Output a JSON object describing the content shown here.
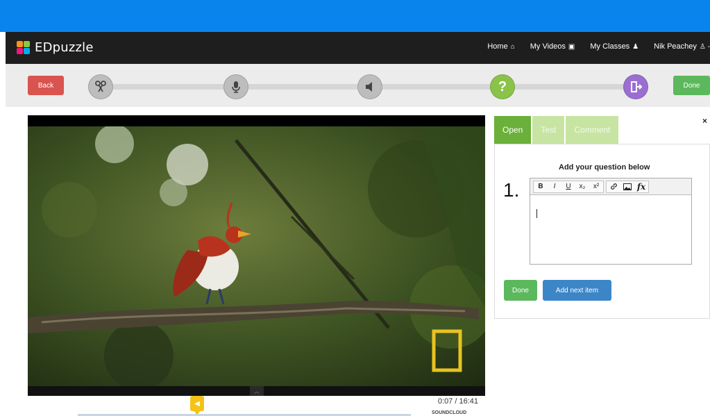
{
  "navbar": {
    "logo_text": "EDpuzzle",
    "links": [
      {
        "label": "Home",
        "icon": "home-icon"
      },
      {
        "label": "My Videos",
        "icon": "video-icon"
      },
      {
        "label": "My Classes",
        "icon": "users-icon"
      },
      {
        "label": "Nik Peachey",
        "icon": "user-icon"
      }
    ]
  },
  "steps": {
    "back_label": "Back",
    "done_label": "Done",
    "items": [
      {
        "name": "cut",
        "icon": "scissors-icon",
        "active": false
      },
      {
        "name": "voiceover",
        "icon": "microphone-icon",
        "active": false
      },
      {
        "name": "audio-notes",
        "icon": "speaker-icon",
        "active": false
      },
      {
        "name": "quiz",
        "icon": "question-icon",
        "active": true
      },
      {
        "name": "finish",
        "icon": "exit-icon",
        "active": false
      }
    ],
    "quiz_symbol": "?"
  },
  "video": {
    "time": "0:07 / 16:41",
    "soundcloud": "SOUNDCLOUD"
  },
  "question_panel": {
    "tabs": [
      "Open",
      "Test",
      "Comment"
    ],
    "active_tab": "Open",
    "prompt": "Add your question below",
    "number": "1.",
    "toolbar": [
      "B",
      "I",
      "U",
      "x₂",
      "x²",
      "link",
      "image",
      "fx"
    ],
    "done_label": "Done",
    "next_label": "Add next item",
    "close_symbol": "×"
  },
  "colors": {
    "top_bar": "#0a84ed",
    "navbar": "#1e1e1e",
    "back": "#d9534f",
    "done": "#5cb85c",
    "quiz_step": "#8bc34a",
    "finish_step": "#9b6fd1",
    "tab_active": "#6ab03a",
    "add_next": "#3c86c8",
    "timeline_marker": "#f3c318"
  }
}
